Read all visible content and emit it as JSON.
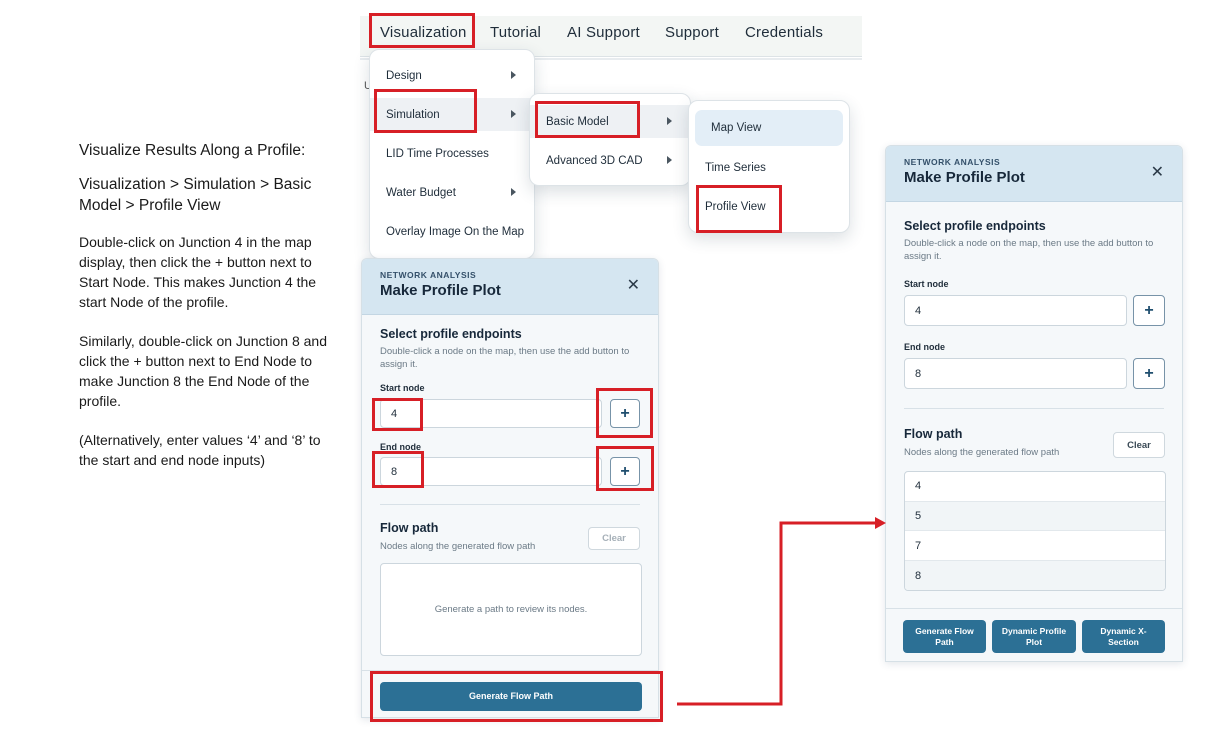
{
  "instructions": {
    "title": "Visualize Results Along a Profile:",
    "menu_path": "Visualization > Simulation > Basic Model > Profile View",
    "para1": "Double-click on Junction 4 in the map display, then click the + button next to Start Node. This makes Junction 4 the start Node of the profile.",
    "para2": "Similarly, double-click on Junction 8 and click the + button next to End Node to make Junction 8 the End Node of the profile.",
    "para3": "(Alternatively, enter values ‘4’ and ‘8’ to the start and end node inputs)"
  },
  "menubar": {
    "items": [
      "Visualization",
      "Tutorial",
      "AI Support",
      "Support",
      "Credentials"
    ],
    "behind_fragment": "U"
  },
  "menus": {
    "visualization": [
      "Design",
      "Simulation",
      "LID Time Processes",
      "Water Budget",
      "Overlay Image On the Map"
    ],
    "simulation": [
      "Basic Model",
      "Advanced 3D CAD"
    ],
    "basic_model": [
      "Map View",
      "Time Series",
      "Profile View"
    ]
  },
  "panel_left": {
    "eyebrow": "NETWORK ANALYSIS",
    "title": "Make Profile Plot",
    "close_glyph": "✕",
    "endpoints_title": "Select profile endpoints",
    "endpoints_help": "Double-click a node on the map, then use the add button to assign it.",
    "start_label": "Start node",
    "start_value": "4",
    "end_label": "End node",
    "end_value": "8",
    "add_glyph": "+",
    "flow_title": "Flow path",
    "flow_help": "Nodes along the generated flow path",
    "clear_label": "Clear",
    "empty_text": "Generate a path to review its nodes.",
    "generate_label": "Generate Flow Path"
  },
  "panel_right": {
    "eyebrow": "NETWORK ANALYSIS",
    "title": "Make Profile Plot",
    "close_glyph": "✕",
    "endpoints_title": "Select profile endpoints",
    "endpoints_help": "Double-click a node on the map, then use the add button to assign it.",
    "start_label": "Start node",
    "start_value": "4",
    "end_label": "End node",
    "end_value": "8",
    "add_glyph": "+",
    "flow_title": "Flow path",
    "flow_help": "Nodes along the generated flow path",
    "clear_label": "Clear",
    "path_nodes": [
      "4",
      "5",
      "7",
      "8"
    ],
    "buttons": [
      "Generate Flow Path",
      "Dynamic Profile Plot",
      "Dynamic X-Section"
    ]
  },
  "colors": {
    "highlight_red": "#d71f26",
    "header_blue": "#d5e6f1",
    "action_button": "#2c7095"
  },
  "icons": [
    "chevron-right-icon",
    "close-icon",
    "plus-icon",
    "arrow-connector-icon"
  ]
}
